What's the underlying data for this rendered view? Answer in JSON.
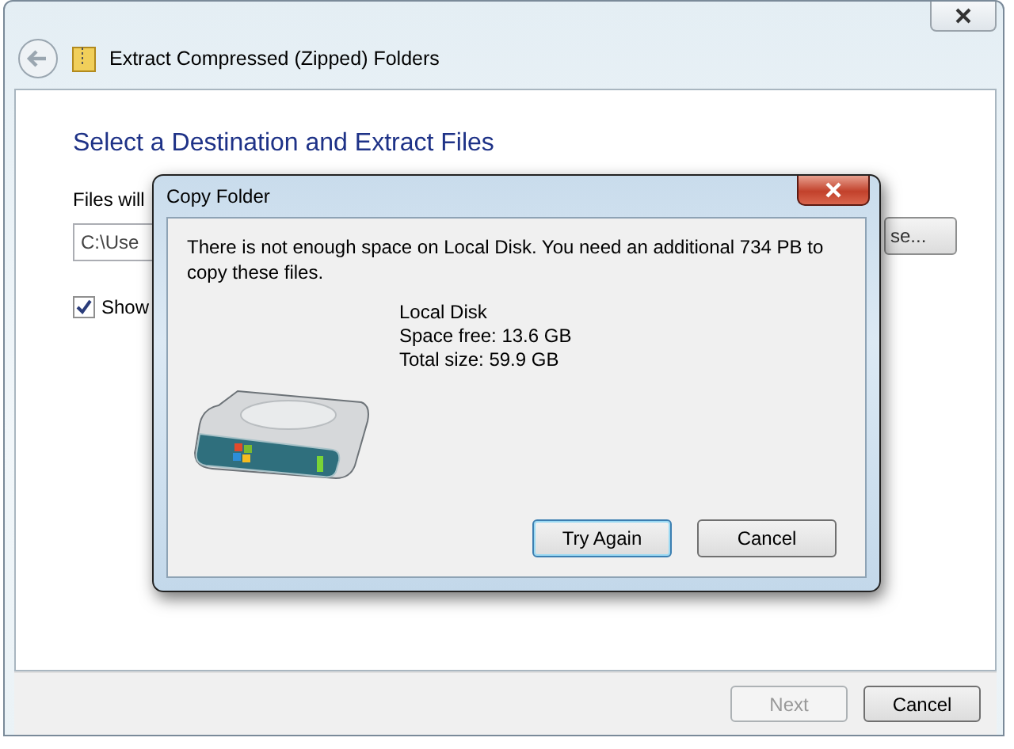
{
  "window": {
    "title": "Extract Compressed (Zipped) Folders",
    "heading": "Select a Destination and Extract Files",
    "destination_label": "Files will",
    "path_field": {
      "value": "C:\\Use"
    },
    "browse_button": "se...",
    "show_checkbox": {
      "label": "Show",
      "checked": true
    },
    "footer_buttons": [
      {
        "label": "Next",
        "disabled": true
      },
      {
        "label": "Cancel",
        "disabled": false
      }
    ]
  },
  "dialog": {
    "title": "Copy Folder",
    "message": "There is not enough space on Local Disk. You need an additional 734 PB to copy these files.",
    "disk_name": "Local Disk",
    "space_free": "Space free: 13.6 GB",
    "total_size": "Total size: 59.9 GB",
    "buttons": [
      {
        "label": "Try Again",
        "default": true
      },
      {
        "label": "Cancel",
        "default": false
      }
    ]
  }
}
